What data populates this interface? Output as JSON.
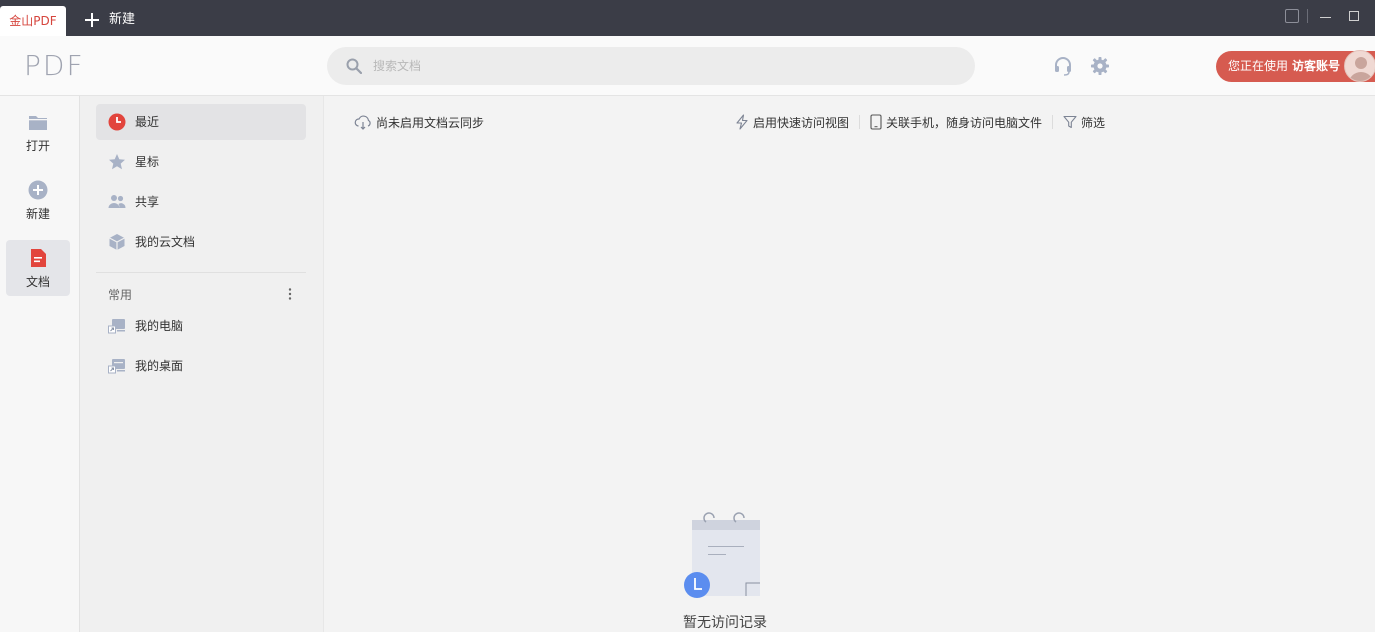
{
  "titlebar": {
    "active_tab": "金山PDF",
    "new_tab_label": "新建"
  },
  "header": {
    "logo": "PDF",
    "search_placeholder": "搜索文档",
    "account_prefix": "您正在使用",
    "account_name": "访客账号"
  },
  "rail": {
    "items": [
      {
        "label": "打开",
        "icon": "folder-icon"
      },
      {
        "label": "新建",
        "icon": "plus-circle-icon"
      },
      {
        "label": "文档",
        "icon": "document-icon",
        "active": true
      }
    ]
  },
  "nav": {
    "items": [
      {
        "label": "最近",
        "icon": "clock-icon",
        "active": true
      },
      {
        "label": "星标",
        "icon": "star-icon"
      },
      {
        "label": "共享",
        "icon": "people-icon"
      },
      {
        "label": "我的云文档",
        "icon": "cloud-box-icon"
      }
    ],
    "section_title": "常用",
    "common": [
      {
        "label": "我的电脑",
        "icon": "computer-shortcut-icon"
      },
      {
        "label": "我的桌面",
        "icon": "desktop-shortcut-icon"
      }
    ]
  },
  "main": {
    "cloud_sync": "尚未启用文档云同步",
    "quick_view": "启用快速访问视图",
    "link_phone": "关联手机，随身访问电脑文件",
    "filter": "筛选",
    "empty_text": "暂无访问记录"
  },
  "colors": {
    "accent": "#d65b50",
    "titlebar": "#3b3d47",
    "icon_gray": "#a8b2c6",
    "empty_blue": "#5b8def"
  }
}
